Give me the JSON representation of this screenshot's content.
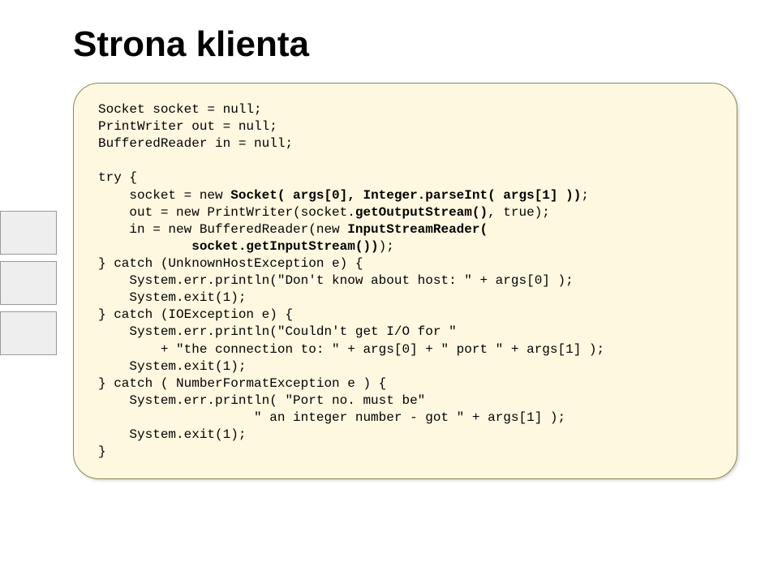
{
  "title": "Strona klienta",
  "code": {
    "l01": "Socket socket = null;",
    "l02": "PrintWriter out = null;",
    "l03": "BufferedReader in = null;",
    "l04": "",
    "l05": "try {",
    "l06a": "    socket = new ",
    "l06b": "Socket( args[0], Integer.parseInt( args[1] ))",
    "l06c": ";",
    "l07a": "    out = new PrintWriter(socket.",
    "l07b": "getOutputStream()",
    "l07c": ", true);",
    "l08a": "    in = new BufferedReader(new ",
    "l08b": "InputStreamReader(",
    "l09b": "            socket.getInputStream())",
    "l09c": ");",
    "l10": "} catch (UnknownHostException e) {",
    "l11": "    System.err.println(\"Don't know about host: \" + args[0] );",
    "l12": "    System.exit(1);",
    "l13": "} catch (IOException e) {",
    "l14": "    System.err.println(\"Couldn't get I/O for \"",
    "l15": "        + \"the connection to: \" + args[0] + \" port \" + args[1] );",
    "l16": "    System.exit(1);",
    "l17": "} catch ( NumberFormatException e ) {",
    "l18": "    System.err.println( \"Port no. must be\"",
    "l19": "                    \" an integer number - got \" + args[1] );",
    "l20": "    System.exit(1);",
    "l21": "}"
  }
}
